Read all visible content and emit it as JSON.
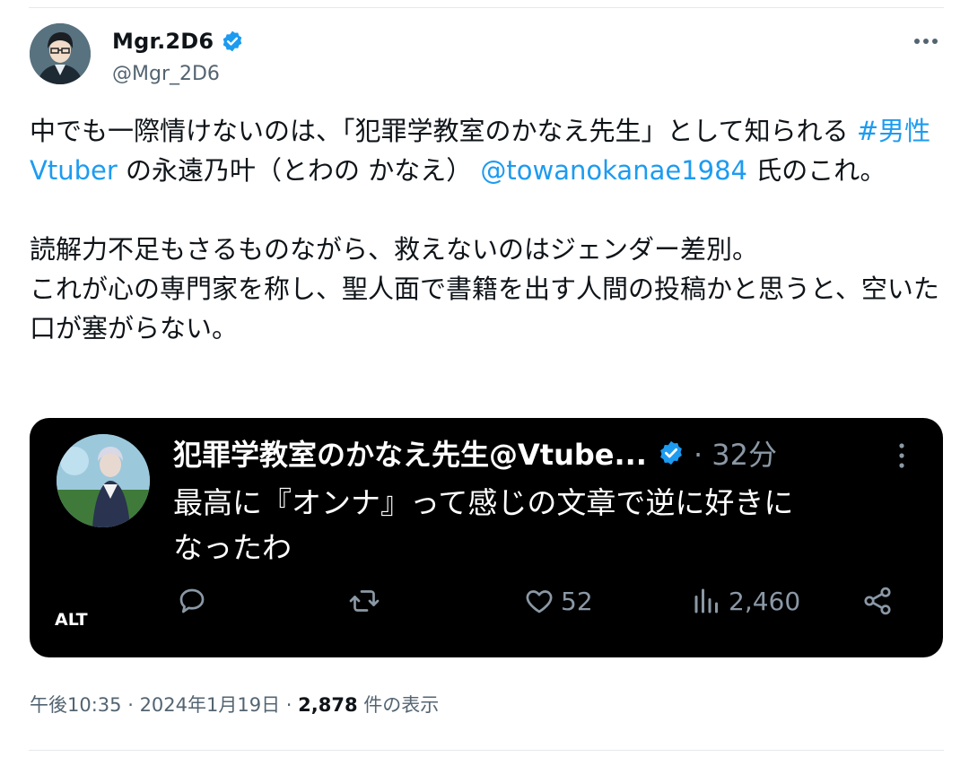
{
  "tweet": {
    "author": {
      "display_name": "Mgr.2D6",
      "handle": "@Mgr_2D6",
      "verified": true,
      "avatar_icon": "anime-man-avatar"
    },
    "more_icon": "more-horizontal-icon",
    "body": {
      "p1_part1": "中でも一際情けないのは、「犯罪学教室のかなえ先生」として知られる ",
      "p1_hashtag": "#男性Vtuber",
      "p1_part2": " の永遠乃叶（とわの かなえ） ",
      "p1_mention": "@towanokanae1984",
      "p1_part3": " 氏のこれ。",
      "p2_line1": "読解力不足もさるものながら、救えないのはジェンダー差別。",
      "p2_line2": "これが心の専門家を称し、聖人面で書籍を出す人間の投稿かと思うと、空いた口が塞がらない。"
    },
    "embedded_screenshot": {
      "alt_badge": "ALT",
      "author_name": "犯罪学教室のかなえ先生@Vtube...",
      "verified": true,
      "time": "· 32分",
      "text_line1": "最高に『オンナ』って感じの文章で逆に好きに",
      "text_line2": "なったわ",
      "actions": {
        "reply_icon": "reply-icon",
        "retweet_icon": "retweet-icon",
        "like_icon": "heart-icon",
        "like_count": "52",
        "views_icon": "views-chart-icon",
        "views_count": "2,460",
        "share_icon": "share-icon"
      }
    },
    "meta": {
      "time": "午後10:35",
      "sep1": " · ",
      "date": "2024年1月19日",
      "sep2": " · ",
      "views": "2,878",
      "views_label": " 件の表示"
    }
  },
  "colors": {
    "link": "#1d9bf0",
    "verified": "#1d9bf0",
    "muted": "#536471",
    "card_bg": "#000000"
  }
}
